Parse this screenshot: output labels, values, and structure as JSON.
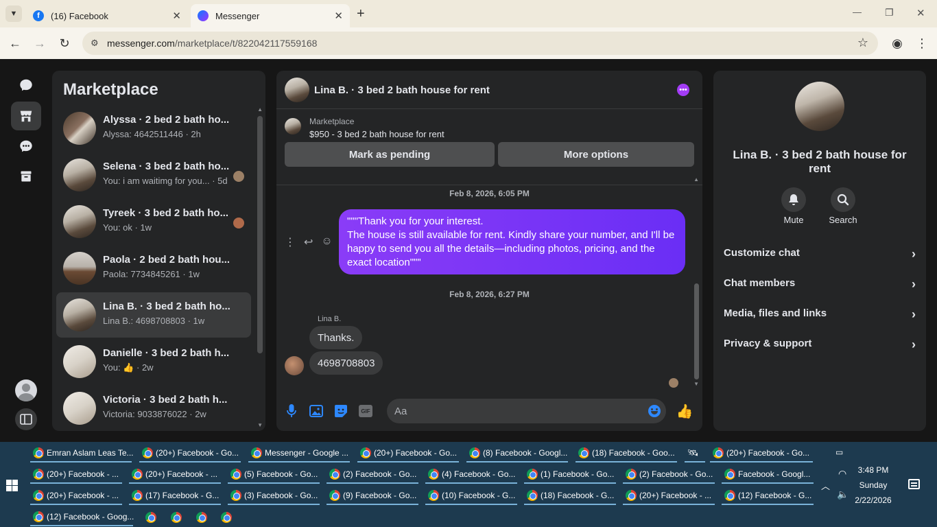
{
  "browser": {
    "tabs": [
      {
        "label": "(16) Facebook",
        "active": false
      },
      {
        "label": "Messenger",
        "active": true
      }
    ],
    "new_tab": "+",
    "url_host": "messenger.com",
    "url_path": "/marketplace/t/822042117559168",
    "window_controls": {
      "minimize": "—",
      "restore": "❐",
      "close": "✕"
    }
  },
  "sidebar": {
    "title": "Marketplace",
    "conversations": [
      {
        "name": "Alyssa · 2 bed 2 bath ho...",
        "snippet": "Alyssa: 4642511446 · 2h"
      },
      {
        "name": "Selena · 3 bed 2 bath ho...",
        "snippet": "You: i am waitimg for you... · 5d"
      },
      {
        "name": "Tyreek · 3 bed 2 bath ho...",
        "snippet": "You: ok · 1w"
      },
      {
        "name": "Paola · 2 bed 2 bath hou...",
        "snippet": "Paola: 7734845261 · 1w"
      },
      {
        "name": "Lina B. · 3 bed 2 bath ho...",
        "snippet": "Lina B.: 4698708803 · 1w"
      },
      {
        "name": "Danielle · 3 bed 2 bath h...",
        "snippet_prefix": "You:",
        "snippet": "· 2w"
      },
      {
        "name": "Victoria · 3 bed 2 bath h...",
        "snippet": "Victoria: 9033876022 · 2w"
      }
    ]
  },
  "chat": {
    "title": "Lina B. · 3 bed 2 bath house for rent",
    "listing_source": "Marketplace",
    "listing": "$950 - 3 bed 2 bath house for rent",
    "mark_pending": "Mark as pending",
    "more_options": "More options",
    "timestamp_1": "Feb 8, 2026, 6:05 PM",
    "sent_message": "\"\"\"Thank you for your interest.\nThe house is still available for rent. Kindly share your number, and I'll be happy to send you all the details—including photos, pricing, and the exact location\"\"\"",
    "timestamp_2": "Feb 8, 2026, 6:27 PM",
    "sender_name": "Lina B.",
    "received": [
      "Thanks.",
      "4698708803"
    ],
    "composer_placeholder": "Aa"
  },
  "info": {
    "name": "Lina B. · 3 bed 2 bath house for rent",
    "mute": "Mute",
    "search": "Search",
    "rows": [
      "Customize chat",
      "Chat members",
      "Media, files and links",
      "Privacy & support"
    ]
  },
  "taskbar": {
    "row1": [
      "Emran Aslam Leas Te...",
      "(20+) Facebook - Go...",
      "Messenger - Google ...",
      "(20+) Facebook - Go...",
      "(8) Facebook - Googl...",
      "(18) Facebook - Goo...",
      "",
      "(20+) Facebook - Go..."
    ],
    "row2": [
      "(20+) Facebook - ...",
      "(20+) Facebook - ...",
      "(5) Facebook - Go...",
      "(2) Facebook - Go...",
      "(4) Facebook - Go...",
      "(1) Facebook - Go...",
      "(2) Facebook - Go...",
      "Facebook - Googl..."
    ],
    "row3": [
      "(20+) Facebook - ...",
      "(17) Facebook - G...",
      "(3) Facebook - Go...",
      "(9) Facebook - Go...",
      "(10) Facebook - G...",
      "(18) Facebook - G...",
      "(20+) Facebook - ...",
      "(12) Facebook - G..."
    ],
    "row4": [
      "(12) Facebook - Goog..."
    ],
    "time": "3:48 PM",
    "day": "Sunday",
    "date": "2/22/2026"
  }
}
